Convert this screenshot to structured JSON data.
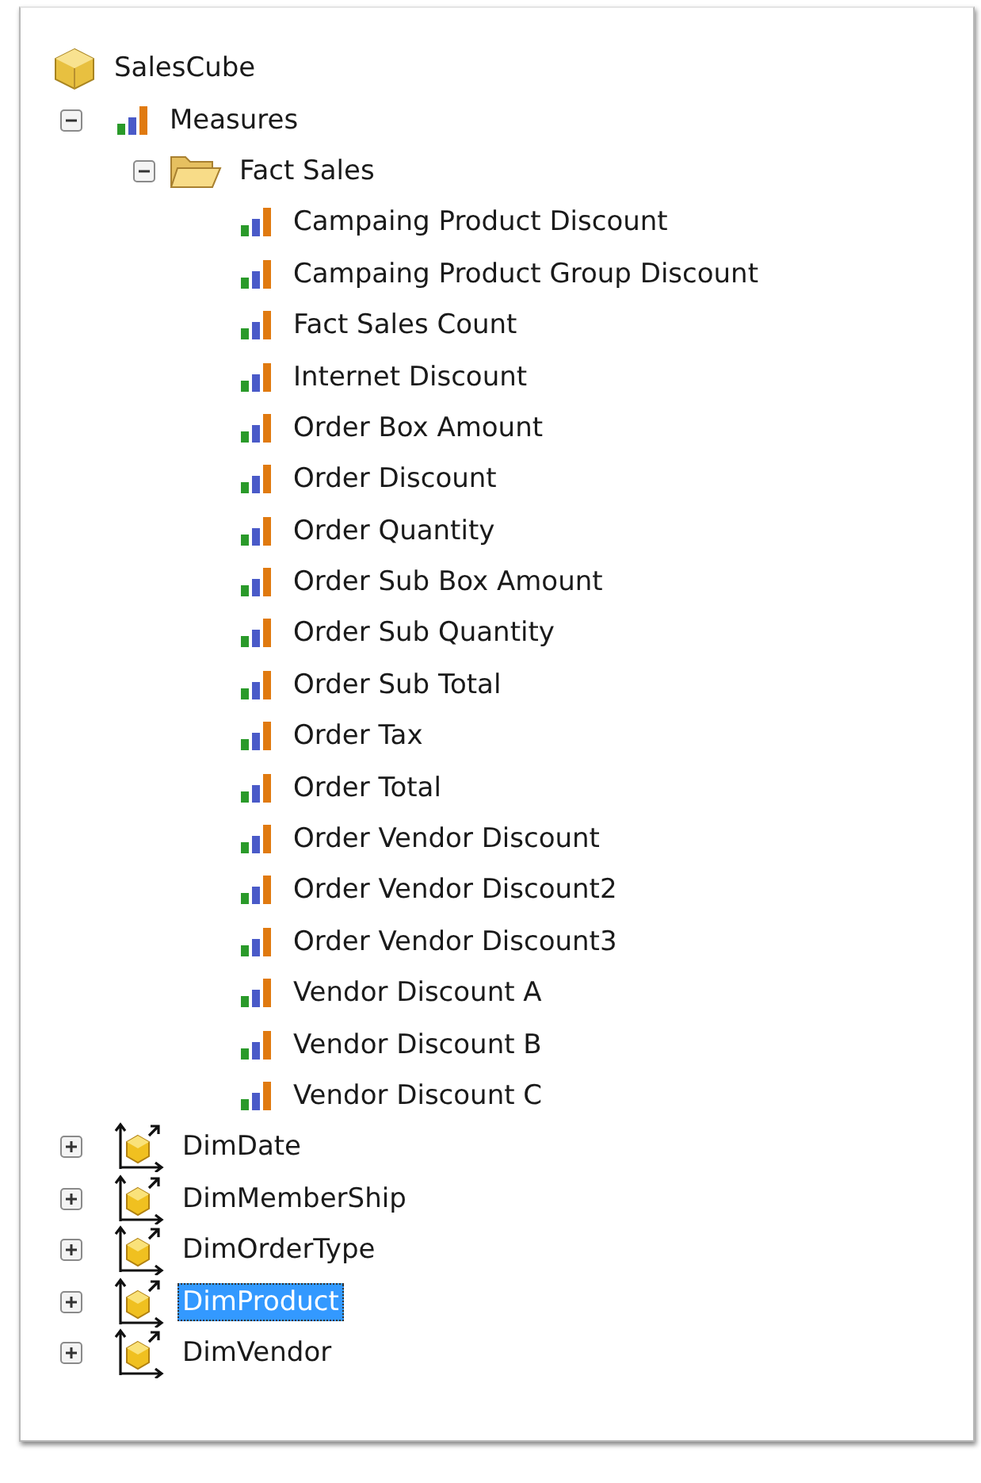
{
  "tree": {
    "label": "SalesCube",
    "kind": "cube",
    "selected": false,
    "children": [
      {
        "label": "Measures",
        "kind": "measures",
        "expanded": true,
        "selected": false,
        "children": [
          {
            "label": "Fact Sales",
            "kind": "folder",
            "expanded": true,
            "selected": false,
            "children": [
              {
                "label": "Campaing Product Discount",
                "kind": "measure",
                "selected": false
              },
              {
                "label": "Campaing Product Group Discount",
                "kind": "measure",
                "selected": false
              },
              {
                "label": "Fact Sales Count",
                "kind": "measure",
                "selected": false
              },
              {
                "label": "Internet Discount",
                "kind": "measure",
                "selected": false
              },
              {
                "label": "Order Box Amount",
                "kind": "measure",
                "selected": false
              },
              {
                "label": "Order Discount",
                "kind": "measure",
                "selected": false
              },
              {
                "label": "Order Quantity",
                "kind": "measure",
                "selected": false
              },
              {
                "label": "Order Sub Box Amount",
                "kind": "measure",
                "selected": false
              },
              {
                "label": "Order Sub Quantity",
                "kind": "measure",
                "selected": false
              },
              {
                "label": "Order Sub Total",
                "kind": "measure",
                "selected": false
              },
              {
                "label": "Order Tax",
                "kind": "measure",
                "selected": false
              },
              {
                "label": "Order Total",
                "kind": "measure",
                "selected": false
              },
              {
                "label": "Order Vendor Discount",
                "kind": "measure",
                "selected": false
              },
              {
                "label": "Order Vendor Discount2",
                "kind": "measure",
                "selected": false
              },
              {
                "label": "Order Vendor Discount3",
                "kind": "measure",
                "selected": false
              },
              {
                "label": "Vendor Discount A",
                "kind": "measure",
                "selected": false
              },
              {
                "label": "Vendor Discount B",
                "kind": "measure",
                "selected": false
              },
              {
                "label": "Vendor Discount C",
                "kind": "measure",
                "selected": false
              }
            ]
          }
        ]
      },
      {
        "label": "DimDate",
        "kind": "dimension",
        "expanded": false,
        "selected": false
      },
      {
        "label": "DimMemberShip",
        "kind": "dimension",
        "expanded": false,
        "selected": false
      },
      {
        "label": "DimOrderType",
        "kind": "dimension",
        "expanded": false,
        "selected": false
      },
      {
        "label": "DimProduct",
        "kind": "dimension",
        "expanded": false,
        "selected": true
      },
      {
        "label": "DimVendor",
        "kind": "dimension",
        "expanded": false,
        "selected": false
      }
    ]
  }
}
